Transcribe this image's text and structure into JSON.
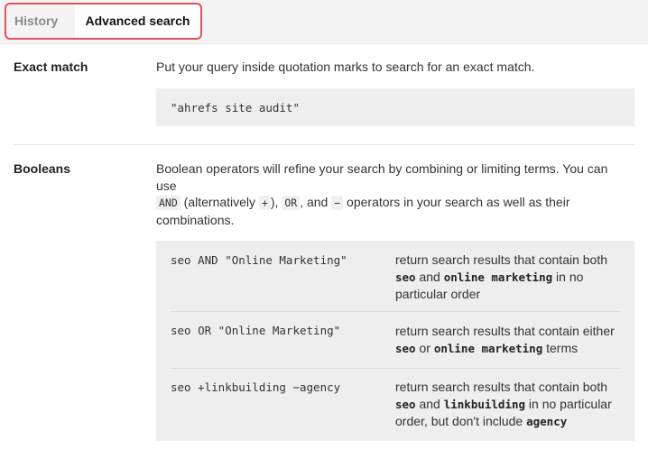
{
  "tabs": {
    "history": "History",
    "advanced": "Advanced search"
  },
  "exact_match": {
    "title": "Exact match",
    "description": "Put your query inside quotation marks to search for an exact match.",
    "example": "\"ahrefs site audit\""
  },
  "booleans": {
    "title": "Booleans",
    "desc_line1": "Boolean operators will refine your search by combining or limiting terms. You can",
    "desc_line2": "use",
    "op_and": "AND",
    "text_alt": " (alternatively ",
    "op_plus": "+",
    "text_close": "),",
    "op_or": "OR",
    "text_and": ", and",
    "op_minus": "−",
    "text_tail": " operators in your search as well as their",
    "desc_line4": "combinations.",
    "examples": [
      {
        "query": "seo AND \"Online Marketing\"",
        "d1": "return search results that contain both",
        "k1": "seo",
        "t1": " and ",
        "k2": "online marketing",
        "t2": " in no",
        "d3": "particular order"
      },
      {
        "query": "seo OR \"Online Marketing\"",
        "d1": "return search results that contain either",
        "k1": "seo",
        "t1": " or ",
        "k2": "online marketing",
        "t2": " terms"
      },
      {
        "query": "seo +linkbuilding −agency",
        "d1": "return search results that contain both",
        "k1": "seo",
        "t1": " and ",
        "k2": "linkbuilding",
        "t2": " in no particular",
        "d3": "order, but don't include ",
        "k3": "agency"
      }
    ]
  }
}
